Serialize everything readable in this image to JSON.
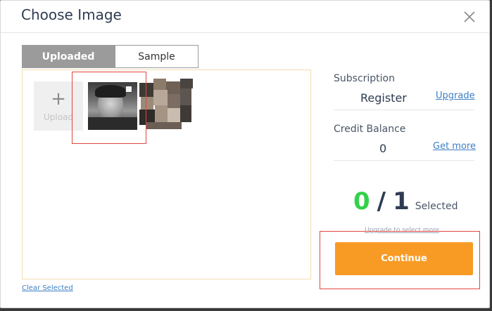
{
  "modal": {
    "title": "Choose Image",
    "close_icon": "close-icon"
  },
  "tabs": [
    {
      "label": "Uploaded",
      "active": true
    },
    {
      "label": "Sample",
      "active": false
    }
  ],
  "gallery": {
    "upload_label": "Upload",
    "upload_icon": "plus-icon",
    "images": [
      {
        "name": "portrait-photo",
        "selected": false
      },
      {
        "name": "pixelated-image",
        "selected": false
      }
    ]
  },
  "clear_selected": "Clear Selected",
  "subscription": {
    "label": "Subscription",
    "value": "Register",
    "link": "Upgrade"
  },
  "credit": {
    "label": "Credit Balance",
    "value": "0",
    "link": "Get more"
  },
  "selection": {
    "selected": "0",
    "separator": "/",
    "max": "1",
    "label": "Selected",
    "upgrade_hint": "Upgrade to select more"
  },
  "continue_label": "Continue",
  "colors": {
    "accent": "#f79b25",
    "count_green": "#33d14a",
    "link_blue": "#3d7fc3",
    "highlight_red": "#e0463f"
  }
}
